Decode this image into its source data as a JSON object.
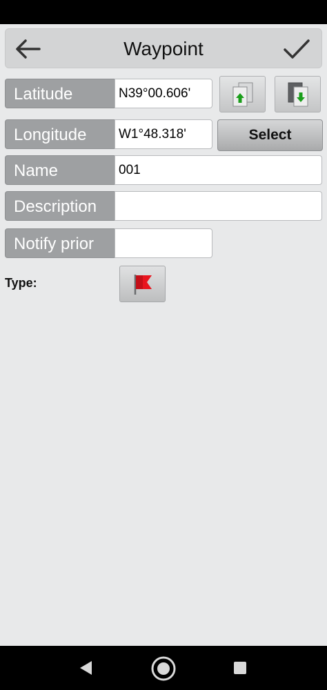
{
  "header": {
    "title": "Waypoint",
    "back_icon": "back-arrow-icon",
    "confirm_icon": "checkmark-icon"
  },
  "fields": {
    "latitude": {
      "label": "Latitude",
      "value": "N39°00.606'"
    },
    "longitude": {
      "label": "Longitude",
      "value": "W1°48.318'"
    },
    "name": {
      "label": "Name",
      "value": "001"
    },
    "description": {
      "label": "Description",
      "value": ""
    },
    "notify_prior": {
      "label": "Notify prior",
      "value": ""
    }
  },
  "buttons": {
    "select_label": "Select",
    "upload_icon": "upload-arrow-icon",
    "download_icon": "download-arrow-icon"
  },
  "type": {
    "label": "Type:",
    "icon": "red-flag-icon"
  },
  "navigation": {
    "back_icon": "nav-back-icon",
    "home_icon": "nav-home-icon",
    "recents_icon": "nav-recents-icon"
  },
  "colors": {
    "label_bg": "#9ea0a2",
    "flag_red": "#e8141e",
    "arrow_green": "#1a9e1a"
  }
}
